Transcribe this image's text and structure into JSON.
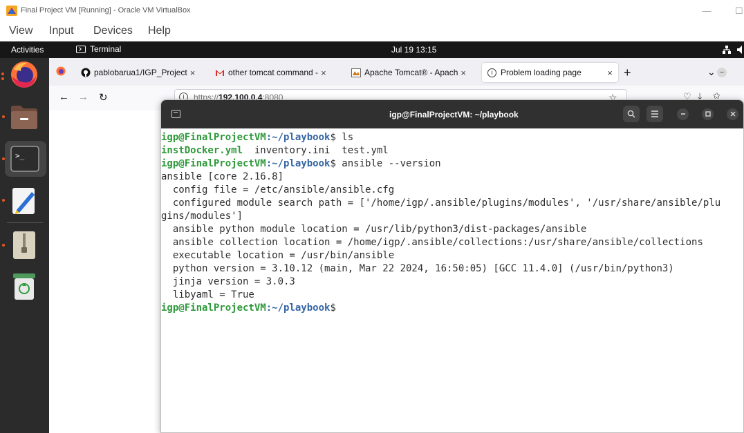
{
  "host_window": {
    "title": "Final Project VM [Running] - Oracle VM VirtualBox",
    "minimize_glyph": "—",
    "maximize_glyph": "☐"
  },
  "host_menu": {
    "items": [
      "View",
      "Input",
      "Devices",
      "Help"
    ]
  },
  "gnome_bar": {
    "activities": "Activities",
    "app_name": "Terminal",
    "clock": "Jul 19  13:15"
  },
  "dock": {
    "items": [
      "firefox-icon",
      "files-icon",
      "terminal-icon",
      "text-editor-icon",
      "archive-icon",
      "trash-icon"
    ]
  },
  "firefox": {
    "tabs": [
      {
        "label": "pablobarua1/IGP_Project",
        "close": "×",
        "icon": "github-icon"
      },
      {
        "label": "other tomcat command -",
        "close": "×",
        "icon": "gmail-icon"
      },
      {
        "label": "Apache Tomcat® - Apach",
        "close": "×",
        "icon": "tomcat-icon"
      },
      {
        "label": "Problem loading page",
        "close": "×",
        "icon": "info-icon"
      }
    ],
    "new_tab": "+",
    "tab_list": "⌄",
    "url_prefix": "https://",
    "url_host": "192.100.0.4",
    "url_suffix": ":8080",
    "minimize": "–"
  },
  "terminal": {
    "title": "igp@FinalProjectVM: ~/playbook",
    "prompt_user": "igp@FinalProjectVM",
    "prompt_path": ":~/playbook",
    "prompt_sym": "$",
    "cmd1": " ls",
    "ls_file1": "instDocker.yml",
    "ls_rest": "  inventory.ini  test.yml",
    "cmd2": " ansible --version",
    "output": [
      "ansible [core 2.16.8]",
      "  config file = /etc/ansible/ansible.cfg",
      "  configured module search path = ['/home/igp/.ansible/plugins/modules', '/usr/share/ansible/plu",
      "gins/modules']",
      "  ansible python module location = /usr/lib/python3/dist-packages/ansible",
      "  ansible collection location = /home/igp/.ansible/collections:/usr/share/ansible/collections",
      "  executable location = /usr/bin/ansible",
      "  python version = 3.10.12 (main, Mar 22 2024, 16:50:05) [GCC 11.4.0] (/usr/bin/python3)",
      "  jinja version = 3.0.3",
      "  libyaml = True"
    ]
  },
  "colors": {
    "gnome_bar": "#171717",
    "dock": "#2b2b2b",
    "terminal_header": "#303030",
    "prompt_user": "#2e9a3a",
    "prompt_path": "#3465a4",
    "ubuntu_orange": "#e95420"
  }
}
